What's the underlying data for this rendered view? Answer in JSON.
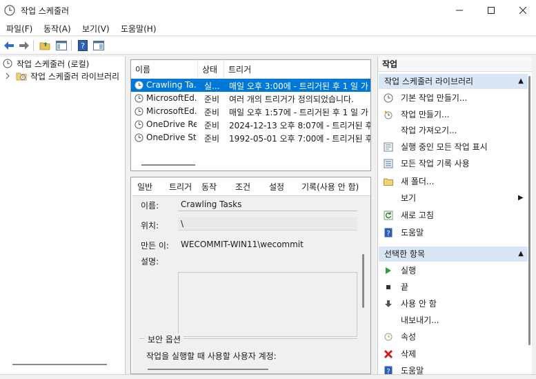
{
  "window": {
    "title": "작업 스케줄러"
  },
  "menu": [
    "파일(F)",
    "동작(A)",
    "보기(V)",
    "도움말(H)"
  ],
  "tree": [
    {
      "label": "작업 스케줄러 (로컬)"
    },
    {
      "label": "작업 스케줄러 라이브러리"
    }
  ],
  "task_list": {
    "columns": [
      "이름",
      "상태",
      "트리거"
    ],
    "rows": [
      {
        "name": "Crawling Ta...",
        "status": "실...",
        "trigger": "매일 오후 3:00에 - 트리거된 후 1 일 가",
        "selected": true
      },
      {
        "name": "MicrosoftEd...",
        "status": "준비",
        "trigger": "여러 개의 트리거가 정의되었습니다.",
        "selected": false
      },
      {
        "name": "MicrosoftEd...",
        "status": "준비",
        "trigger": "매일 오후 1:57에 - 트리거된 후 1 일 가",
        "selected": false
      },
      {
        "name": "OneDrive Re...",
        "status": "준비",
        "trigger": "2024-12-13 오후 8:07에 - 트리거된 후",
        "selected": false
      },
      {
        "name": "OneDrive St...",
        "status": "준비",
        "trigger": "1992-05-01 오후 7:00에 - 트리거된 후",
        "selected": false
      }
    ]
  },
  "details": {
    "tabs": [
      "일반",
      "트리거",
      "동작",
      "조건",
      "설정",
      "기록(사용 안 함)"
    ],
    "name_label": "이름:",
    "name_value": "Crawling Tasks",
    "location_label": "위치:",
    "location_value": "\\",
    "author_label": "만든 이:",
    "author_value": "WECOMMIT-WIN11\\wecommit",
    "description_label": "설명:",
    "security_group": "보안 옵션",
    "security_text": "작업을 실행할 때 사용할 사용자 계정:"
  },
  "actions": {
    "title": "작업",
    "section1": "작업 스케줄러 라이브러리",
    "items1": [
      {
        "label": "기본 작업 만들기...",
        "icon": "create-basic-task-icon"
      },
      {
        "label": "작업 만들기...",
        "icon": "create-task-icon"
      },
      {
        "label": "작업 가져오기...",
        "icon": ""
      },
      {
        "label": "실행 중인 모든 작업 표시",
        "icon": "running-tasks-icon"
      },
      {
        "label": "모든 작업 기록 사용",
        "icon": "history-icon"
      },
      {
        "label": "새 폴더...",
        "icon": "folder-icon"
      },
      {
        "label": "보기",
        "icon": ""
      },
      {
        "label": "새로 고침",
        "icon": "refresh-icon"
      },
      {
        "label": "도움말",
        "icon": "help-icon"
      }
    ],
    "section2": "선택한 항목",
    "items2": [
      {
        "label": "실행",
        "icon": "play-icon"
      },
      {
        "label": "끝",
        "icon": "stop-icon"
      },
      {
        "label": "사용 안 함",
        "icon": "disable-icon"
      },
      {
        "label": "내보내기...",
        "icon": ""
      },
      {
        "label": "속성",
        "icon": "properties-icon"
      },
      {
        "label": "삭제",
        "icon": "delete-icon"
      },
      {
        "label": "도움말",
        "icon": "help-icon"
      }
    ]
  }
}
